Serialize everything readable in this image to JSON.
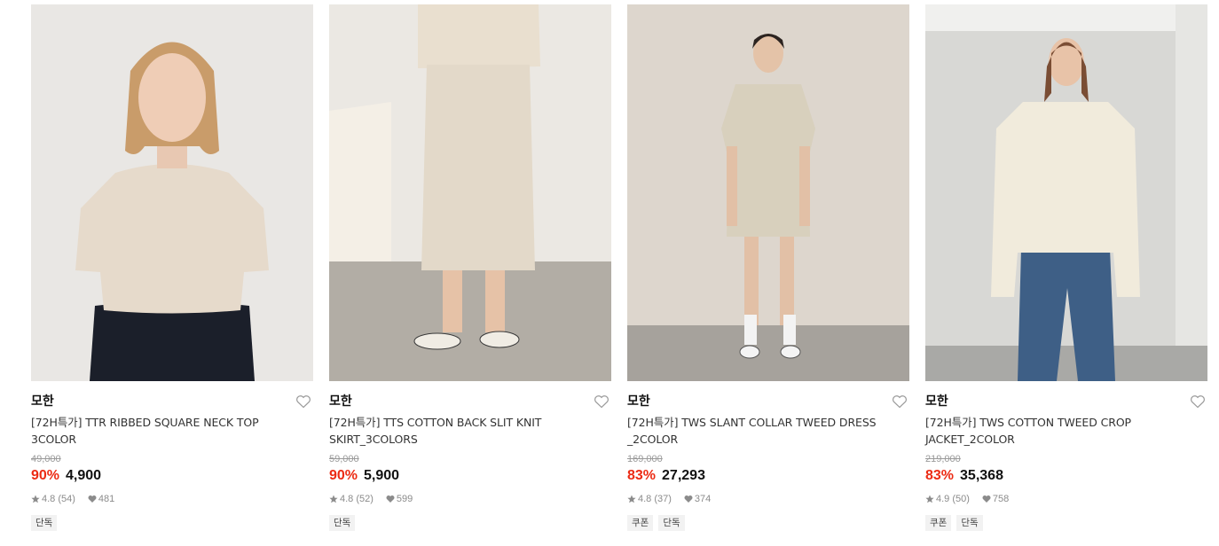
{
  "products": [
    {
      "brand": "모한",
      "title": "[72H특가] TTR RIBBED SQUARE NECK TOP 3COLOR",
      "original_price": "49,000",
      "discount": "90%",
      "price": "4,900",
      "rating": "4.8",
      "reviews": "(54)",
      "likes": "481",
      "tags": [
        "단독"
      ],
      "photo_bg": "#e9e7e4"
    },
    {
      "brand": "모한",
      "title": "[72H특가] TTS COTTON BACK SLIT KNIT SKIRT_3COLORS",
      "original_price": "59,000",
      "discount": "90%",
      "price": "5,900",
      "rating": "4.8",
      "reviews": "(52)",
      "likes": "599",
      "tags": [
        "단독"
      ],
      "photo_bg": "#d9d4ca"
    },
    {
      "brand": "모한",
      "title": "[72H특가] TWS SLANT COLLAR TWEED DRESS _2COLOR",
      "original_price": "169,000",
      "discount": "83%",
      "price": "27,293",
      "rating": "4.8",
      "reviews": "(37)",
      "likes": "374",
      "tags": [
        "쿠폰",
        "단독"
      ],
      "photo_bg": "#ddd6cd"
    },
    {
      "brand": "모한",
      "title": "[72H특가] TWS COTTON TWEED CROP JACKET_2COLOR",
      "original_price": "219,000",
      "discount": "83%",
      "price": "35,368",
      "rating": "4.9",
      "reviews": "(50)",
      "likes": "758",
      "tags": [
        "쿠폰",
        "단독"
      ],
      "photo_bg": "#d8d8d5"
    }
  ],
  "icons": {
    "wishlist": "heart-outline-icon",
    "rating": "star-icon",
    "likes": "heart-filled-icon"
  },
  "colors": {
    "discount": "#ec2b14",
    "price": "#111111",
    "muted": "#9a9a9a",
    "tag_bg": "#f2f2f2"
  }
}
